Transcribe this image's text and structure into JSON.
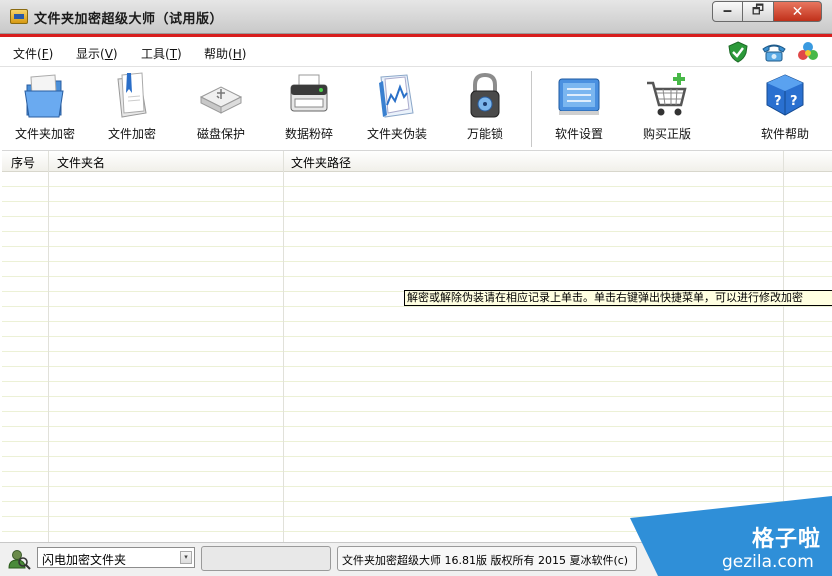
{
  "window": {
    "title": "文件夹加密超级大师（试用版）",
    "controls": {
      "minimize": "🗕",
      "maximize": "🗗",
      "close": "✕"
    }
  },
  "menu": {
    "items": [
      {
        "label": "文件(",
        "key": "F",
        "suffix": ")"
      },
      {
        "label": "显示(",
        "key": "V",
        "suffix": ")"
      },
      {
        "label": "工具(",
        "key": "T",
        "suffix": ")"
      },
      {
        "label": "帮助(",
        "key": "H",
        "suffix": ")"
      }
    ],
    "right_icons": [
      "shield-check-icon",
      "phone-icon",
      "color-balls-icon"
    ]
  },
  "toolbar": {
    "buttons": [
      {
        "label": "文件夹加密",
        "icon": "folder-lock-icon"
      },
      {
        "label": "文件加密",
        "icon": "document-lock-icon"
      },
      {
        "label": "磁盘保护",
        "icon": "usb-disk-icon"
      },
      {
        "label": "数据粉碎",
        "icon": "shredder-icon"
      },
      {
        "label": "文件夹伪装",
        "icon": "folder-disguise-icon"
      },
      {
        "label": "万能锁",
        "icon": "padlock-icon"
      },
      {
        "label": "软件设置",
        "icon": "settings-panel-icon"
      },
      {
        "label": "购买正版",
        "icon": "shopping-cart-icon"
      },
      {
        "label": "软件帮助",
        "icon": "help-cube-icon"
      }
    ]
  },
  "table": {
    "columns": [
      "序号",
      "文件夹名",
      "文件夹路径"
    ],
    "rows": []
  },
  "tooltip": {
    "text": "解密或解除伪装请在相应记录上单击。单击右键弹出快捷菜单，可以进行修改加密"
  },
  "statusbar": {
    "mode_select": {
      "value": "闪电加密文件夹",
      "arrow": "▾"
    },
    "info": "文件夹加密超级大师 16.81版 版权所有 2015 夏冰软件(c)"
  },
  "watermark": {
    "line1": "格子啦",
    "line2": "gezila.com"
  },
  "colors": {
    "accent_red": "#d81e1e",
    "row_stripe": "#ecf1d6",
    "tooltip_bg": "#ffffe1",
    "watermark_blue": "#2f8fd8"
  }
}
